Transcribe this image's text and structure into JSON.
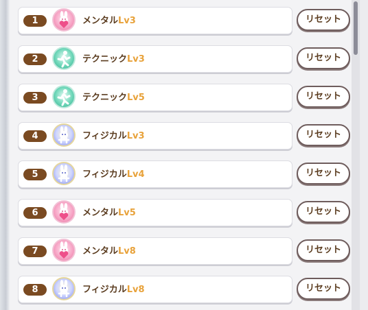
{
  "rows": [
    {
      "num": "1",
      "name": "メンタル",
      "level": "Lv3",
      "badge_icon": "mental-rabbit-heart-icon",
      "badge_type": "mental"
    },
    {
      "num": "2",
      "name": "テクニック",
      "level": "Lv3",
      "badge_icon": "technic-runner-icon",
      "badge_type": "technic"
    },
    {
      "num": "3",
      "name": "テクニック",
      "level": "Lv5",
      "badge_icon": "technic-runner-icon",
      "badge_type": "technic"
    },
    {
      "num": "4",
      "name": "フィジカル",
      "level": "Lv3",
      "badge_icon": "physical-rabbit-icon",
      "badge_type": "physical"
    },
    {
      "num": "5",
      "name": "フィジカル",
      "level": "Lv4",
      "badge_icon": "physical-rabbit-icon",
      "badge_type": "physical"
    },
    {
      "num": "6",
      "name": "メンタル",
      "level": "Lv5",
      "badge_icon": "mental-rabbit-heart-icon",
      "badge_type": "mental"
    },
    {
      "num": "7",
      "name": "メンタル",
      "level": "Lv8",
      "badge_icon": "mental-rabbit-heart-icon",
      "badge_type": "mental"
    },
    {
      "num": "8",
      "name": "フィジカル",
      "level": "Lv8",
      "badge_icon": "physical-rabbit-icon",
      "badge_type": "physical"
    }
  ],
  "reset_label": "リセット",
  "colors": {
    "number_badge": "#7a4a21",
    "level_text": "#e8a23a",
    "name_text": "#5a3b1e"
  }
}
